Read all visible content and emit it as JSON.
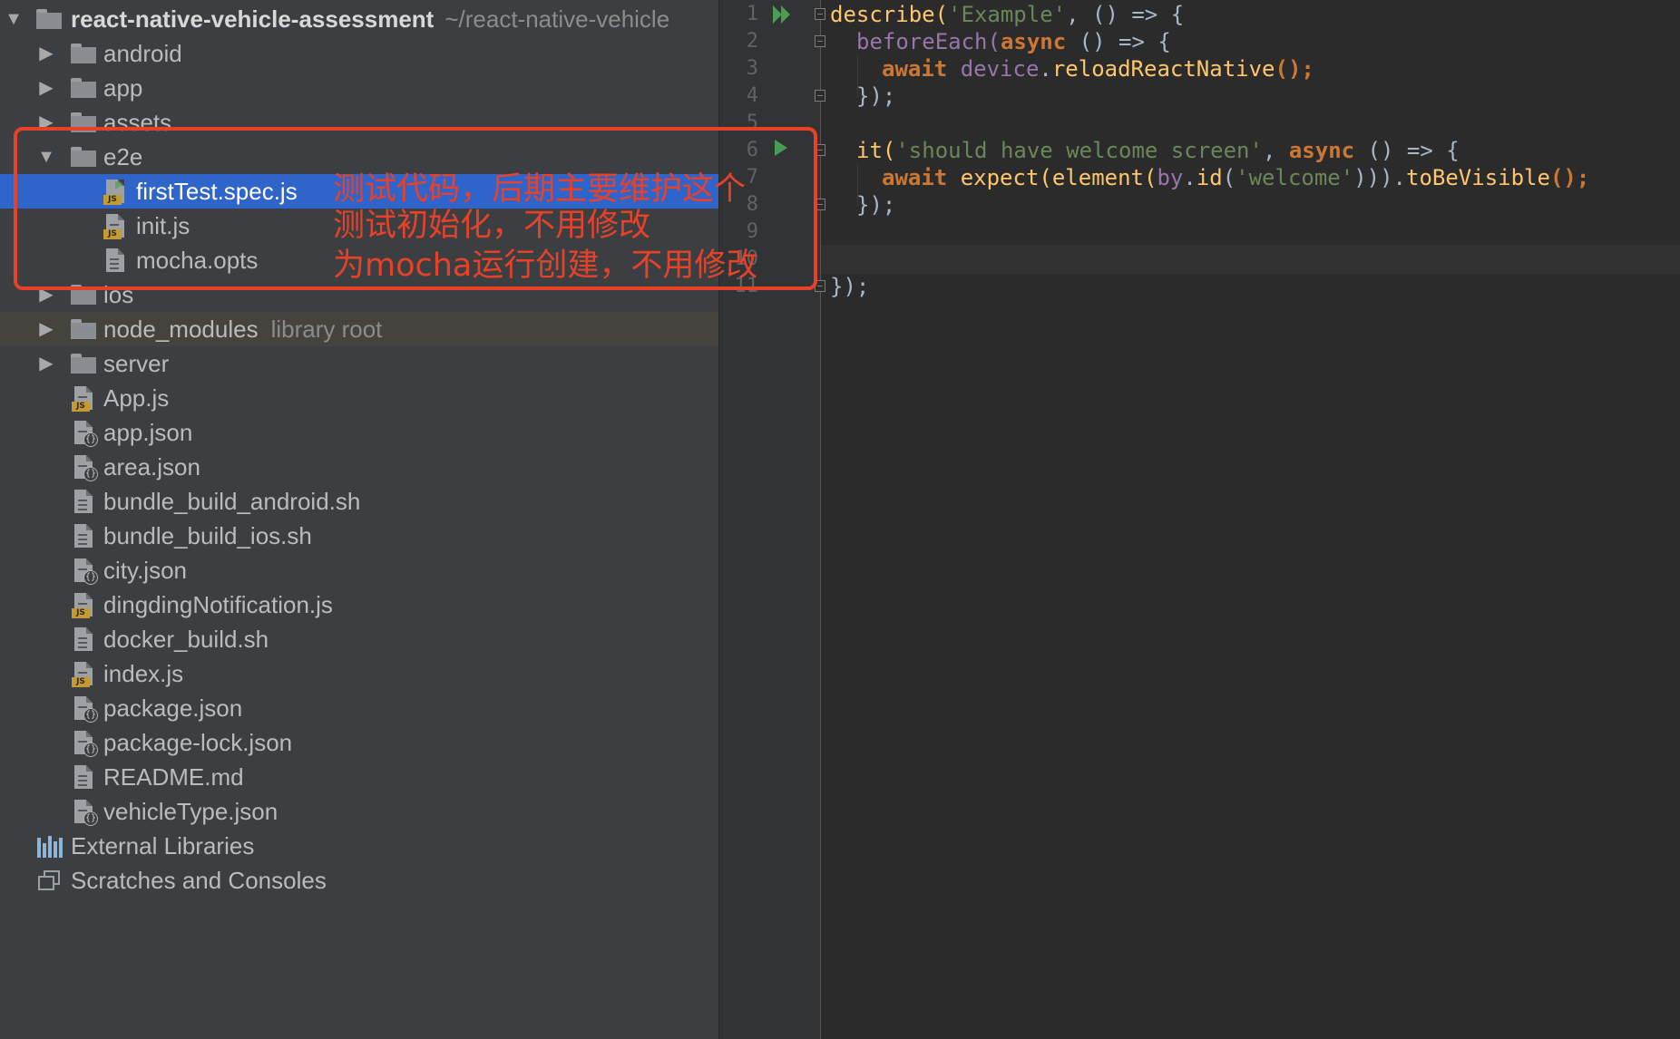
{
  "tree": {
    "root": {
      "name": "react-native-vehicle-assessment",
      "path": "~/react-native-vehicle"
    },
    "items": [
      {
        "label": "android",
        "kind": "folder"
      },
      {
        "label": "app",
        "kind": "folder"
      },
      {
        "label": "assets",
        "kind": "folder"
      },
      {
        "label": "e2e",
        "kind": "folder"
      },
      {
        "label": "firstTest.spec.js",
        "kind": "js-test"
      },
      {
        "label": "init.js",
        "kind": "js"
      },
      {
        "label": "mocha.opts",
        "kind": "text"
      },
      {
        "label": "ios",
        "kind": "folder"
      },
      {
        "label": "node_modules",
        "kind": "folder",
        "hint": "library root"
      },
      {
        "label": "server",
        "kind": "folder"
      },
      {
        "label": "App.js",
        "kind": "js"
      },
      {
        "label": "app.json",
        "kind": "json"
      },
      {
        "label": "area.json",
        "kind": "json"
      },
      {
        "label": "bundle_build_android.sh",
        "kind": "text"
      },
      {
        "label": "bundle_build_ios.sh",
        "kind": "text"
      },
      {
        "label": "city.json",
        "kind": "json"
      },
      {
        "label": "dingdingNotification.js",
        "kind": "js"
      },
      {
        "label": "docker_build.sh",
        "kind": "text"
      },
      {
        "label": "index.js",
        "kind": "js"
      },
      {
        "label": "package.json",
        "kind": "json"
      },
      {
        "label": "package-lock.json",
        "kind": "json"
      },
      {
        "label": "README.md",
        "kind": "text"
      },
      {
        "label": "vehicleType.json",
        "kind": "json"
      },
      {
        "label": "External Libraries",
        "kind": "libraries"
      },
      {
        "label": "Scratches and Consoles",
        "kind": "scratches"
      }
    ],
    "badges": {
      "js": "JS",
      "json": "{}"
    },
    "selected_index": 4
  },
  "annotations": [
    "测试代码，后期主要维护这个",
    "测试初始化，不用修改",
    "为mocha运行创建，不用修改"
  ],
  "editor": {
    "line_numbers": [
      "1",
      "2",
      "3",
      "4",
      "5",
      "6",
      "7",
      "8",
      "9",
      "10",
      "11"
    ],
    "code": {
      "l1": {
        "a": "describe(",
        "b": "'Example'",
        "c": ", () => {"
      },
      "l2": {
        "a": "beforeEach(",
        "b": "async",
        "c": " () => {"
      },
      "l3": {
        "a": "await",
        "b": "device",
        "c": ".",
        "d": "reloadReactNative",
        "e": "();"
      },
      "l4": {
        "a": "});"
      },
      "l6": {
        "a": "it(",
        "b": "'should have welcome screen'",
        "c": ", ",
        "d": "async",
        "e": " () => {"
      },
      "l7": {
        "a": "await",
        "b": " expect(element(",
        "c": "by",
        "d": ".",
        "e": "id",
        "f": "(",
        "g": "'welcome'",
        "h": "))).",
        "i": "toBeVisible",
        "j": "();"
      },
      "l8": {
        "a": "});"
      },
      "l11": {
        "a": "});"
      }
    }
  },
  "colors": {
    "tree_bg": "#3c3f41",
    "selection": "#2f65ca",
    "annotation": "#e8412a",
    "editor_bg": "#2b2b2b",
    "keyword": "#cc7832",
    "string": "#6a8759",
    "function": "#ffc66d"
  }
}
